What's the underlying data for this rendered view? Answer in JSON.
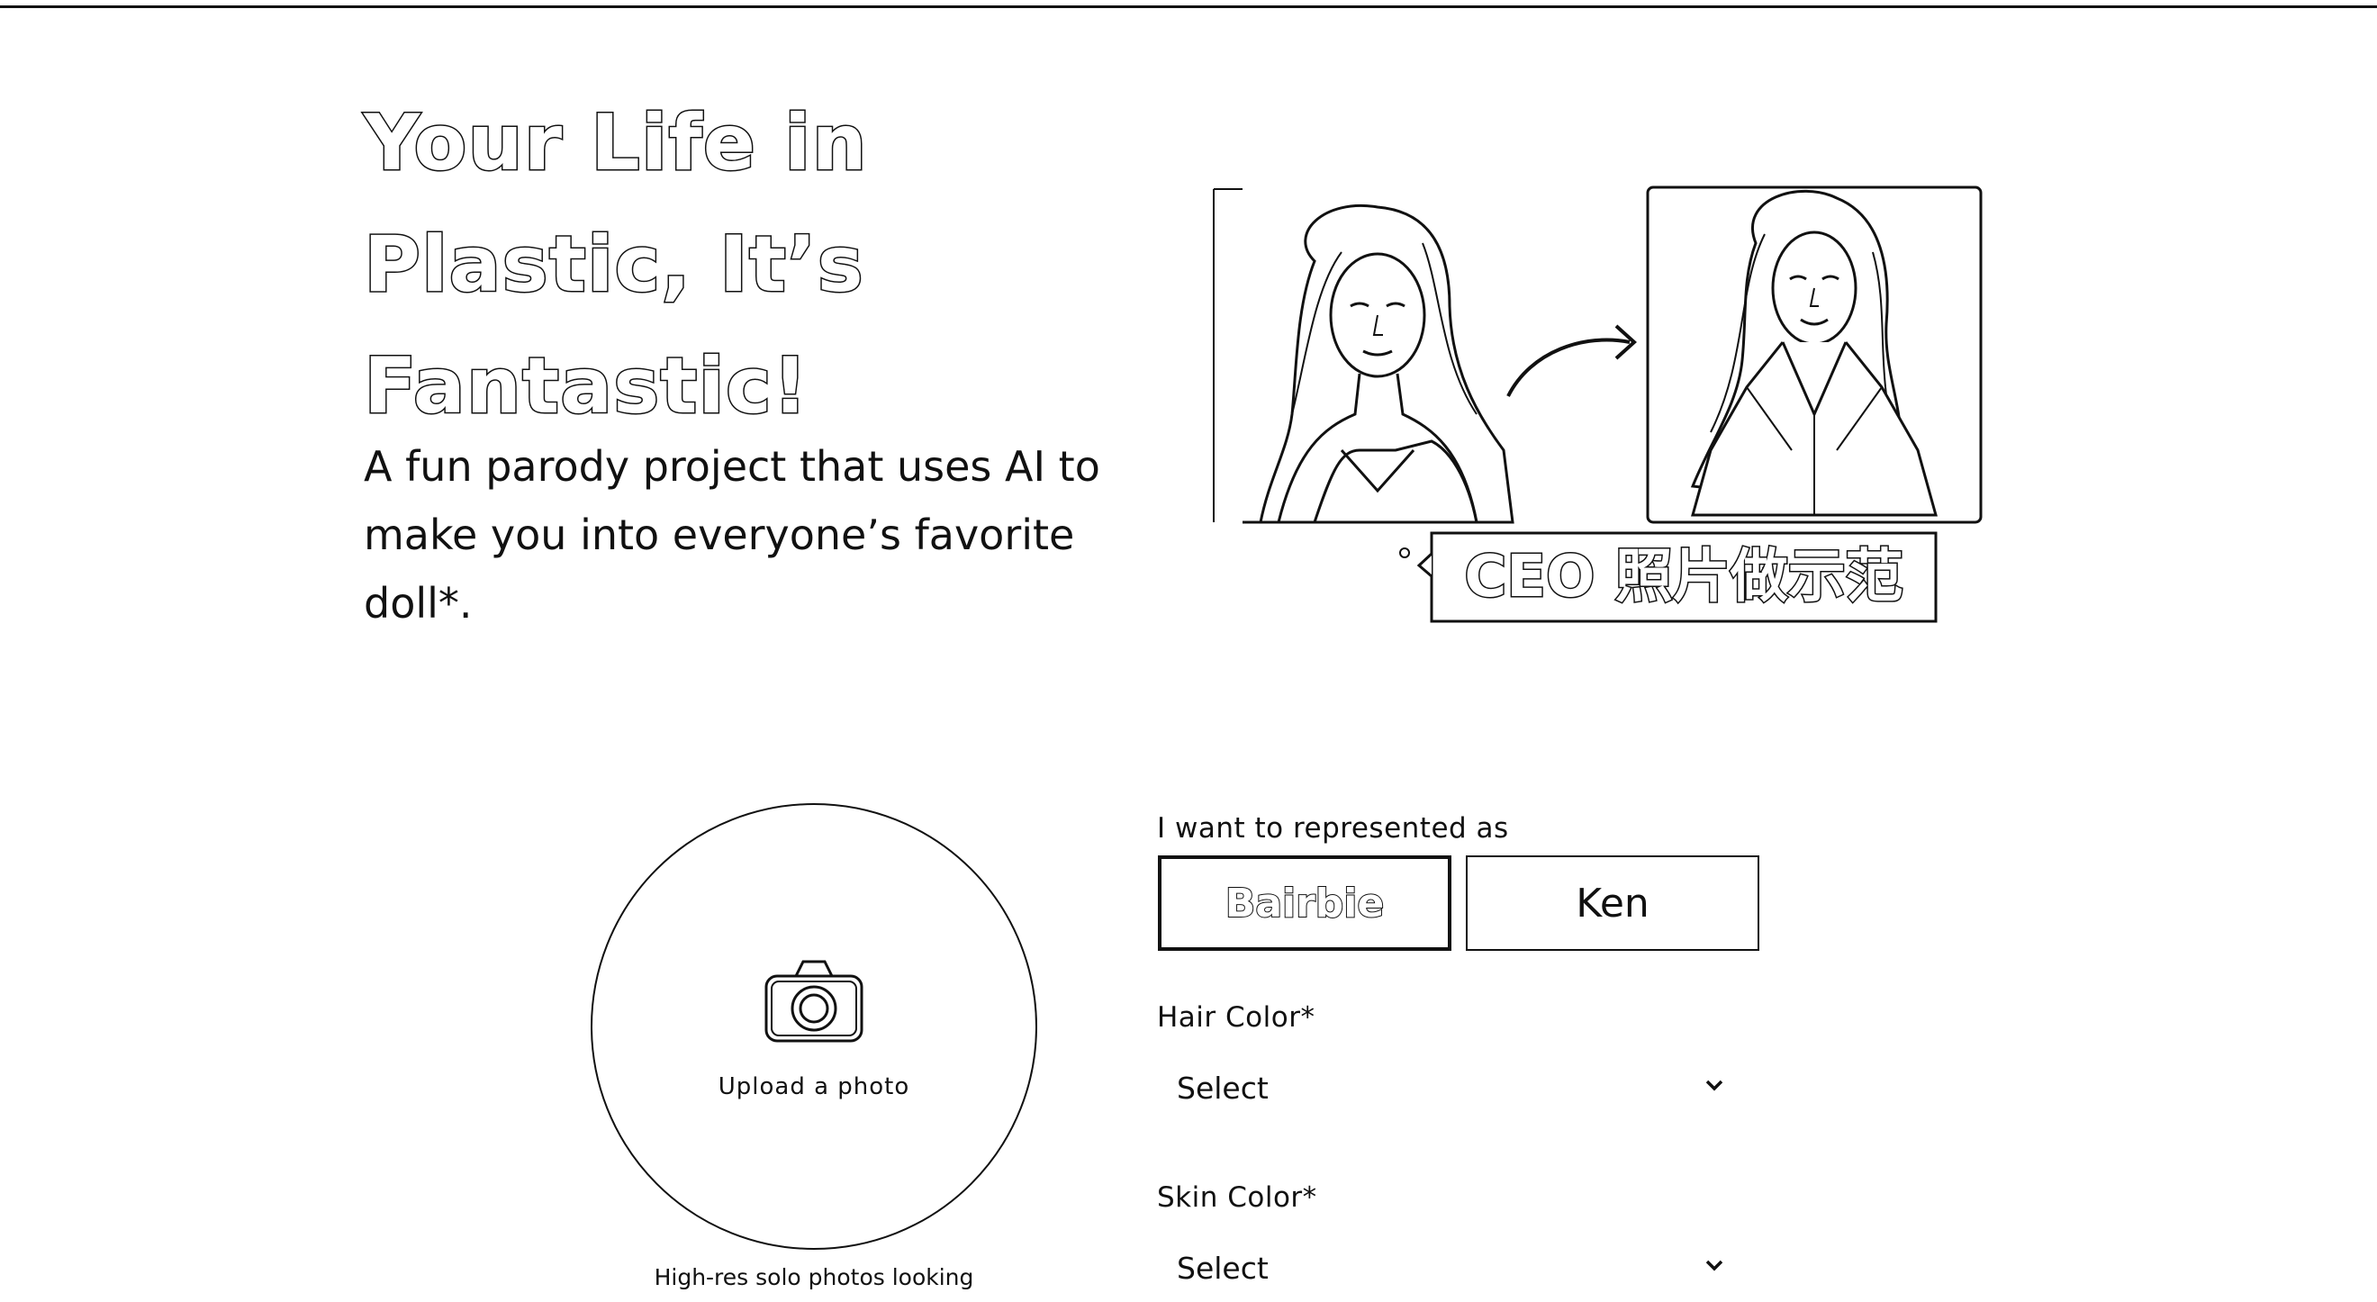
{
  "hero": {
    "title_line1": "Your Life in",
    "title_line2": "Plastic, It’s",
    "title_line3": "Fantastic!",
    "subtitle_line1": "A fun parody project that uses AI to",
    "subtitle_line2": "make you into everyone’s favorite",
    "subtitle_line3": "doll*.",
    "caption": "CEO 照片做示范"
  },
  "upload": {
    "label": "Upload a photo",
    "hint": "High-res solo photos looking"
  },
  "form": {
    "represent_label": "I want to represented as",
    "options": [
      "Bairbie",
      "Ken"
    ],
    "selected_option": "Bairbie",
    "hair_label": "Hair Color*",
    "hair_value": "Select",
    "skin_label": "Skin Color*",
    "skin_value": "Select"
  },
  "icons": {
    "upload": "camera-icon",
    "select_caret": "chevron-down-icon",
    "transform": "arrow-right-icon"
  }
}
